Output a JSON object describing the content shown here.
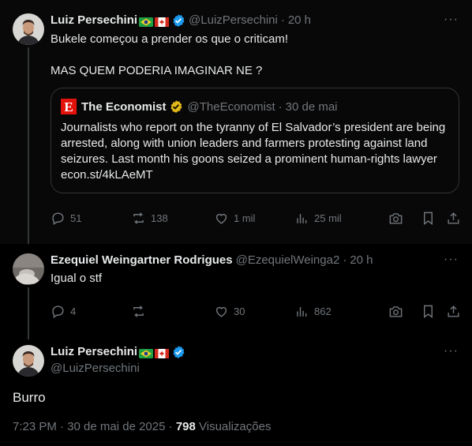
{
  "tweets": [
    {
      "name": "Luiz Persechini",
      "handle": "@LuizPersechini",
      "time": "20 h",
      "text": "Bukele começou a prender os que o criticam!\n\nMAS QUEM PODERIA IMAGINAR NE ?",
      "quote": {
        "logo_letter": "E",
        "name": "The Economist",
        "handle": "@TheEconomist",
        "time": "30 de mai",
        "text": "Journalists who report on the tyranny of El Salvador’s president are being arrested, along with union leaders and farmers protesting against land seizures. Last month his goons seized a prominent human-rights lawyer econ.st/4kLAeMT"
      },
      "actions": {
        "replies": "51",
        "reposts": "138",
        "likes": "1 mil",
        "views": "25 mil"
      }
    },
    {
      "name": "Ezequiel Weingartner Rodrigues",
      "handle": "@EzequielWeinga2",
      "time": "20 h",
      "text": "Igual o stf",
      "actions": {
        "replies": "4",
        "reposts": "",
        "likes": "30",
        "views": "862"
      }
    }
  ],
  "main_tweet": {
    "name": "Luiz Persechini",
    "handle": "@LuizPersechini",
    "text": "Burro",
    "timestamp": "7:23 PM · 30 de mai de 2025",
    "views_count": "798",
    "views_label": "Visualizações"
  },
  "more_label": "···",
  "colors": {
    "background": "#000000",
    "text": "#e7e9ea",
    "muted": "#71767b",
    "verified": "#1d9bf0",
    "gold": "#e2b719",
    "economist": "#e3120b"
  }
}
